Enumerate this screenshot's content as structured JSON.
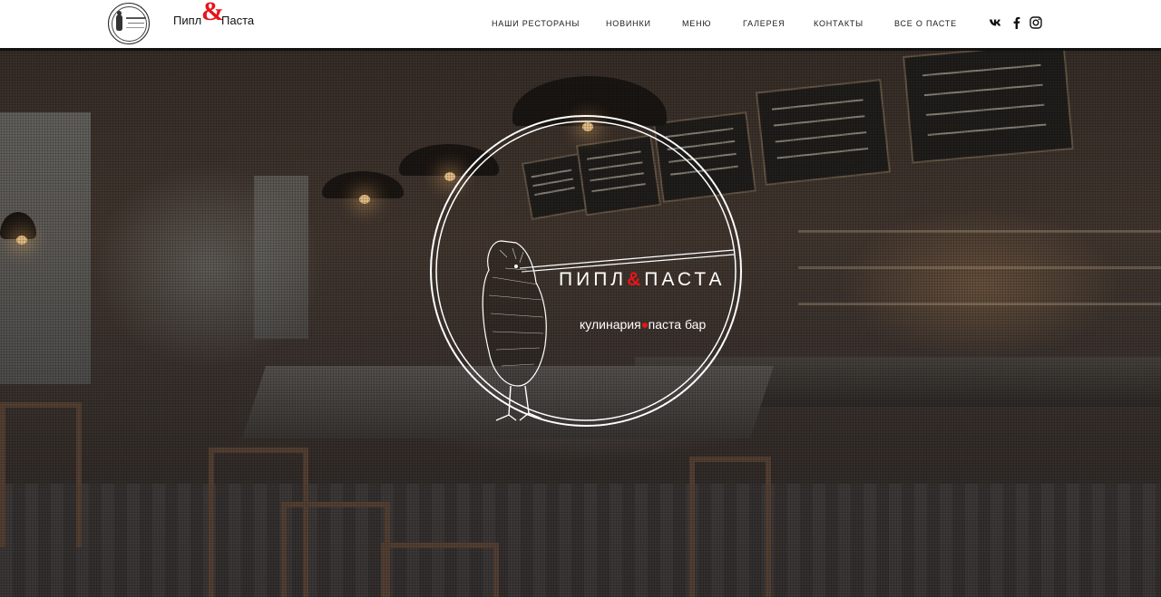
{
  "brand": {
    "part1": "Пипл",
    "ampersand": "&",
    "part2": "Паста"
  },
  "nav": {
    "items": [
      {
        "label": "НАШИ РЕСТОРАНЫ"
      },
      {
        "label": "НОВИНКИ"
      },
      {
        "label": "МЕНЮ"
      },
      {
        "label": "ГАЛЕРЕЯ"
      },
      {
        "label": "КОНТАКТЫ"
      },
      {
        "label": "ВСЕ О ПАСТЕ"
      }
    ]
  },
  "social": {
    "icons": [
      "vk-icon",
      "facebook-icon",
      "instagram-icon"
    ]
  },
  "hero": {
    "title_part1": "ПИПЛ",
    "title_amp": "&",
    "title_part2": "ПАСТА",
    "subtitle_part1": "кулинария",
    "subtitle_part2": "паста бар"
  },
  "colors": {
    "accent": "#e8141a",
    "header_bg": "#ffffff",
    "nav_text": "#1a1a1a"
  }
}
